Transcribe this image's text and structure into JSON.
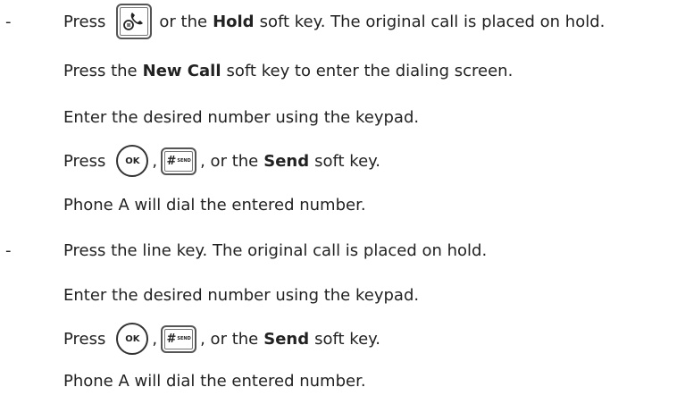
{
  "bullet": "-",
  "step1": {
    "press": "Press",
    "or_the": "or the",
    "hold": "Hold",
    "hold_rest": "soft key. The original call is placed on hold.",
    "new_call_press": "Press the",
    "new_call": "New Call",
    "new_call_rest": "soft key to enter the dialing screen.",
    "enter": "Enter the desired number using the keypad.",
    "press2": "Press",
    "comma": ",",
    "or_the2": ", or the",
    "send": "Send",
    "soft_key": "soft key.",
    "dial": "Phone A will dial the entered number."
  },
  "step2": {
    "line_key": "Press the line key. The original call is placed on hold.",
    "enter": "Enter the desired number using the keypad.",
    "press": "Press",
    "comma": ",",
    "or_the": ", or the",
    "send": "Send",
    "soft_key": "soft key.",
    "dial": "Phone A will dial the entered number."
  },
  "keys": {
    "ok_label": "OK",
    "hash_label": "#",
    "send_small": "SEND"
  },
  "icons": [
    "hold-key-icon",
    "ok-key-icon",
    "send-key-icon"
  ]
}
